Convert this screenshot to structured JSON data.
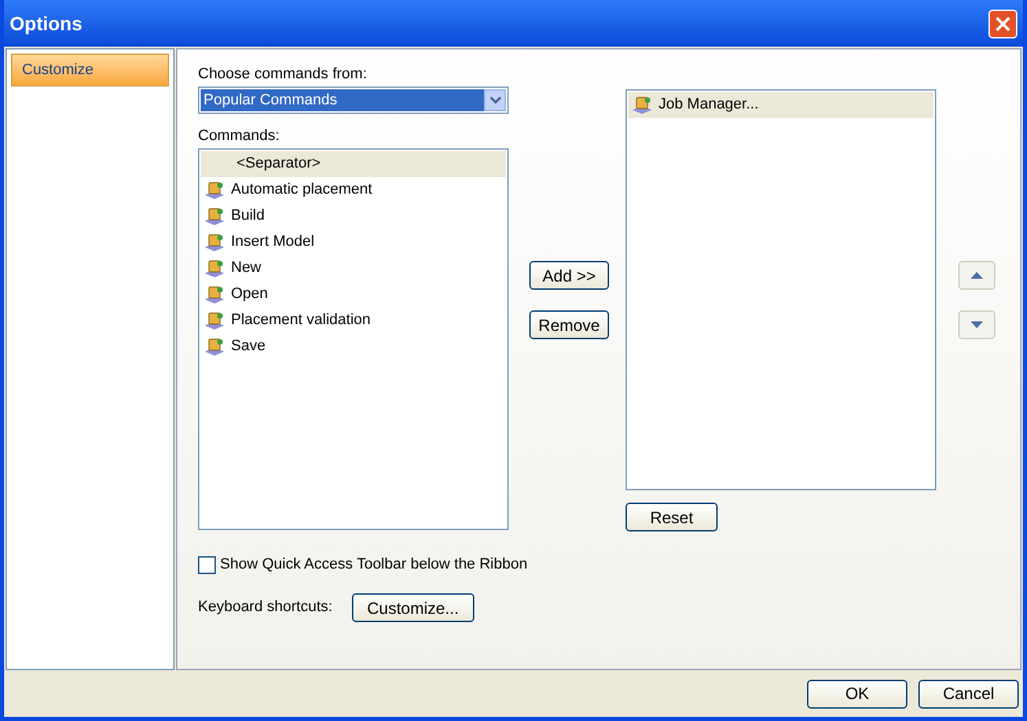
{
  "window": {
    "title": "Options"
  },
  "sidebar": {
    "items": [
      {
        "label": "Customize",
        "selected": true
      }
    ]
  },
  "choose_label": "Choose commands from:",
  "choose_dropdown": {
    "value": "Popular Commands"
  },
  "commands_label": "Commands:",
  "commands": [
    {
      "kind": "separator",
      "label": "<Separator>",
      "selected": true
    },
    {
      "kind": "command",
      "label": "Automatic placement",
      "selected": false
    },
    {
      "kind": "command",
      "label": "Build",
      "selected": false
    },
    {
      "kind": "command",
      "label": "Insert Model",
      "selected": false
    },
    {
      "kind": "command",
      "label": "New",
      "selected": false
    },
    {
      "kind": "command",
      "label": "Open",
      "selected": false
    },
    {
      "kind": "command",
      "label": "Placement validation",
      "selected": false
    },
    {
      "kind": "command",
      "label": "Save",
      "selected": false
    }
  ],
  "add_button": "Add >>",
  "remove_button": "Remove",
  "toolbar_items": [
    {
      "kind": "command",
      "label": "Job Manager...",
      "selected": true
    }
  ],
  "reset_button": "Reset",
  "show_below_ribbon": {
    "label": "Show Quick Access Toolbar below the Ribbon",
    "checked": false
  },
  "keyboard_label": "Keyboard shortcuts:",
  "keyboard_button": "Customize...",
  "footer_buttons": [
    "OK",
    "Cancel"
  ]
}
